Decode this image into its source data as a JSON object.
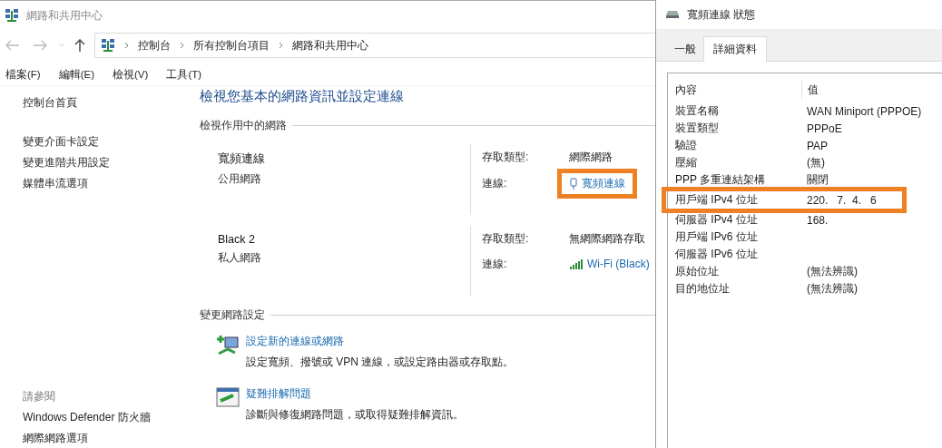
{
  "window": {
    "title": "網路和共用中心"
  },
  "address_bar": {
    "breadcrumbs": [
      "控制台",
      "所有控制台項目",
      "網路和共用中心"
    ]
  },
  "menu_bar": [
    "檔案(F)",
    "編輯(E)",
    "檢視(V)",
    "工具(T)"
  ],
  "sidebar": {
    "items": [
      "控制台首頁",
      "變更介面卡設定",
      "變更進階共用設定",
      "媒體串流選項"
    ],
    "see_also": {
      "title": "請參閱",
      "items": [
        "Windows Defender 防火牆",
        "網際網路選項"
      ]
    }
  },
  "main": {
    "heading": "檢視您基本的網路資訊並設定連線",
    "active_networks": {
      "title": "檢視作用中的網路",
      "networks": [
        {
          "name": "寬頻連線",
          "category": "公用網路",
          "access_type_label": "存取類型:",
          "access_type": "網際網路",
          "connection_label": "連線:",
          "connection": "寬頻連線",
          "kind": "broadband",
          "highlighted": true
        },
        {
          "name": "Black  2",
          "category": "私人網路",
          "access_type_label": "存取類型:",
          "access_type": "無網際網路存取",
          "connection_label": "連線:",
          "connection": "Wi-Fi (Black)",
          "kind": "wifi",
          "highlighted": false
        }
      ]
    },
    "change_settings": {
      "title": "變更網路設定",
      "tasks": [
        {
          "kind": "new_connection",
          "title": "設定新的連線或網路",
          "description": "設定寬頻、撥號或 VPN 連線，或設定路由器或存取點。"
        },
        {
          "kind": "troubleshoot",
          "title": "疑難排解問題",
          "description": "診斷與修復網路問題，或取得疑難排解資訊。"
        }
      ]
    }
  },
  "dialog": {
    "title": "寬頻連線 狀態",
    "tabs": [
      {
        "label": "一般",
        "selected": false
      },
      {
        "label": "詳細資料",
        "selected": true
      }
    ],
    "details": {
      "columns": [
        "內容",
        "值"
      ],
      "rows": [
        {
          "property": "裝置名稱",
          "value": "WAN Miniport (PPPOE)",
          "highlighted": false
        },
        {
          "property": "裝置類型",
          "value": "PPPoE",
          "highlighted": false
        },
        {
          "property": "驗證",
          "value": "PAP",
          "highlighted": false
        },
        {
          "property": "壓縮",
          "value": "(無)",
          "highlighted": false
        },
        {
          "property": "PPP 多重連結架構",
          "value": "關閉",
          "highlighted": false
        },
        {
          "property": "用戶端 IPv4 位址",
          "value": "220.   7.  4.   6",
          "highlighted": true
        },
        {
          "property": "伺服器 IPv4 位址",
          "value": "168.",
          "highlighted": false
        },
        {
          "property": "用戶端 IPv6 位址",
          "highlighted": false
        },
        {
          "property": "伺服器 IPv6 位址",
          "highlighted": false
        },
        {
          "property": "原始位址",
          "value": "(無法辨識)",
          "highlighted": false
        },
        {
          "property": "目的地位址",
          "value": "(無法辨識)",
          "highlighted": false
        }
      ]
    }
  }
}
